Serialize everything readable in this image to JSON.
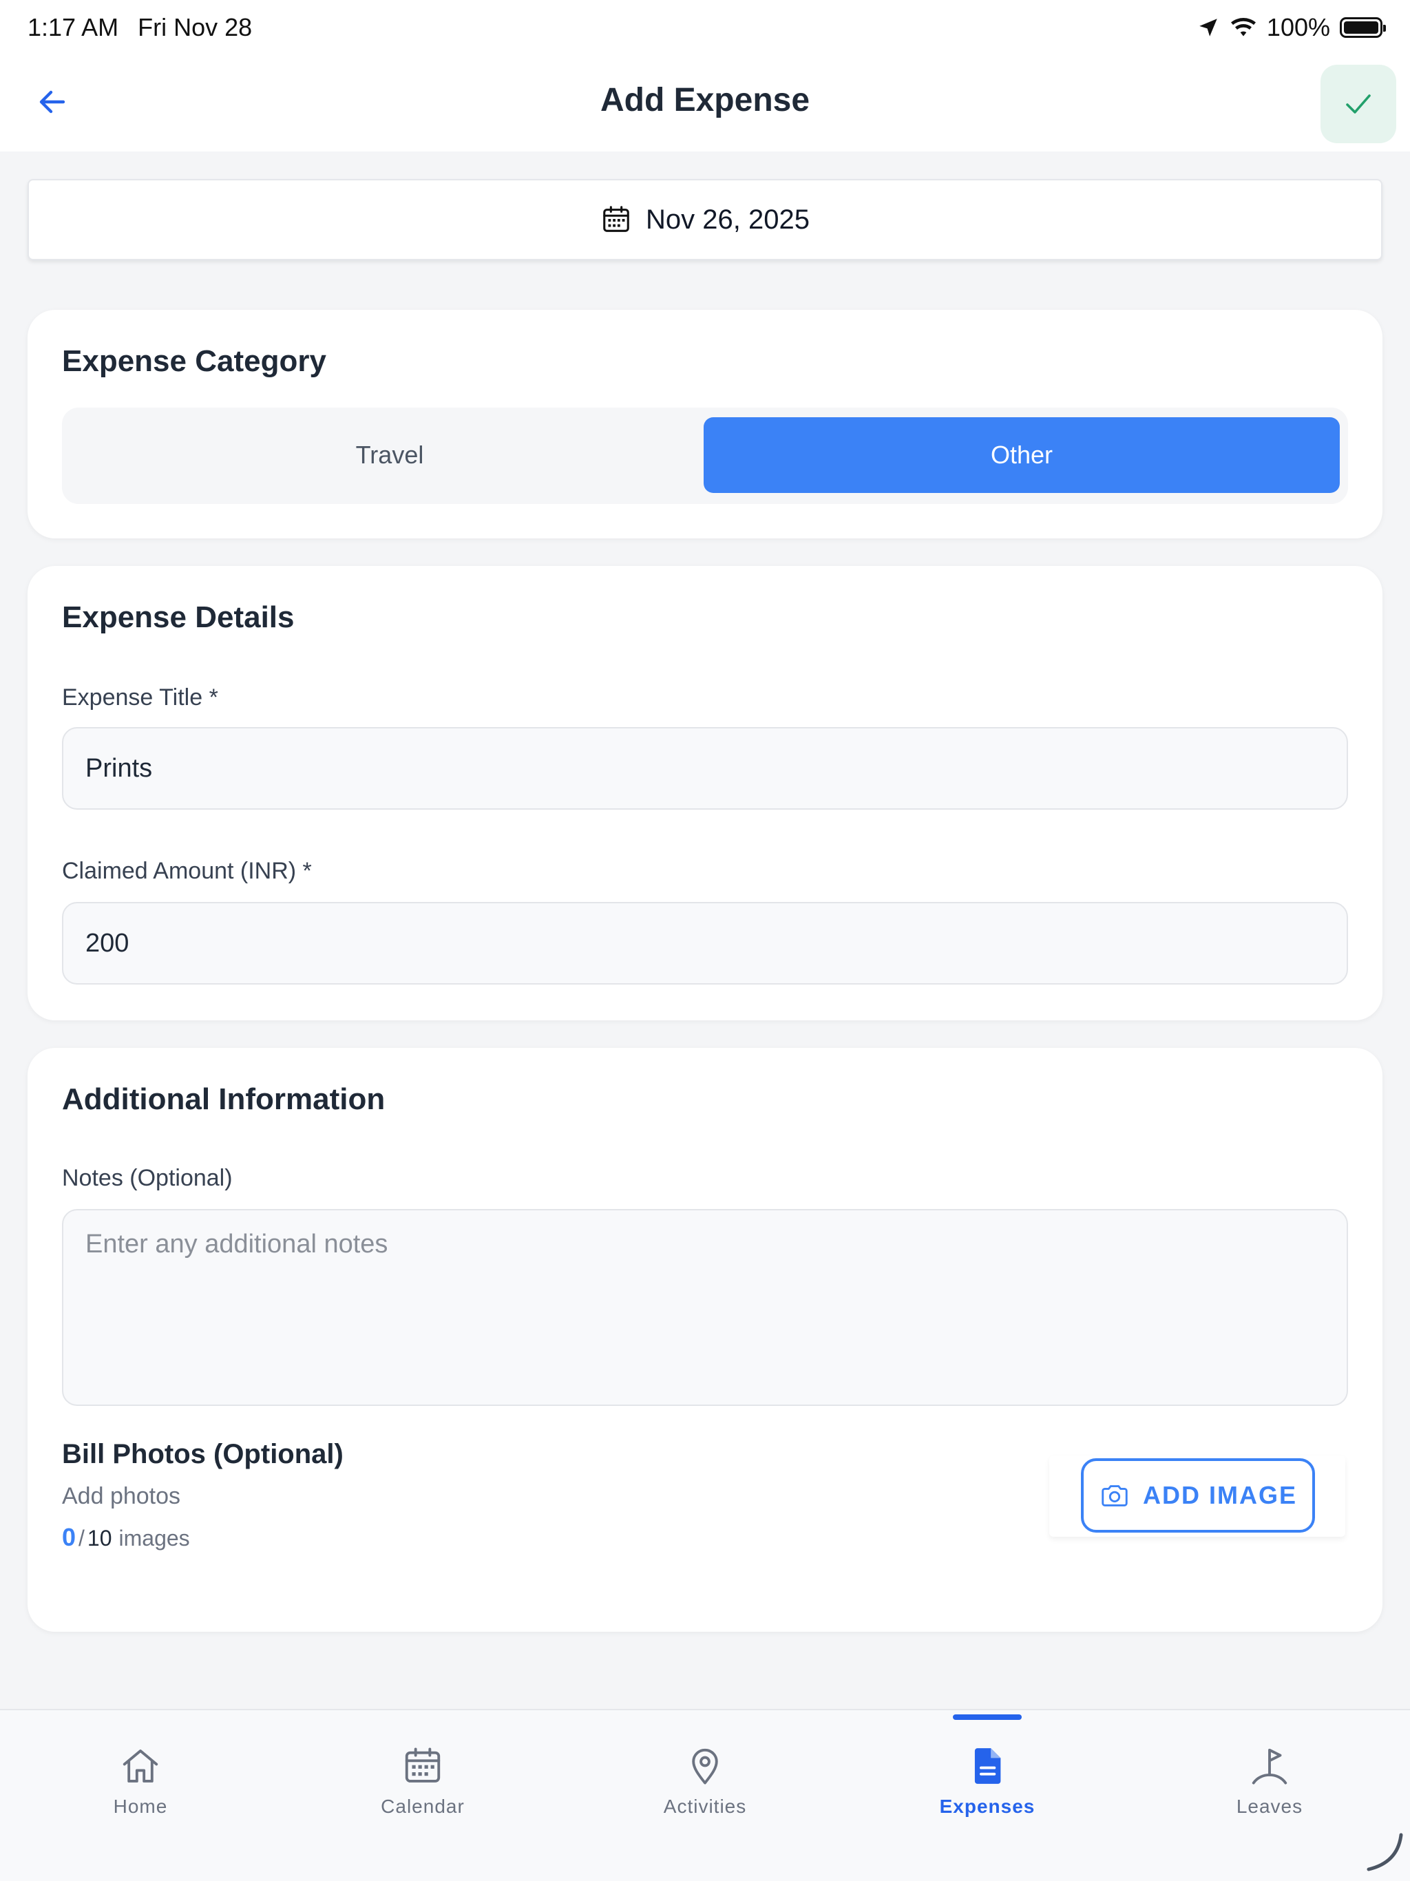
{
  "status_bar": {
    "time": "1:17 AM",
    "date": "Fri Nov 28",
    "battery": "100%"
  },
  "header": {
    "title": "Add Expense",
    "back_icon": "arrow-left-icon",
    "save_icon": "checkmark-icon"
  },
  "date_field": {
    "value": "Nov 26, 2025",
    "icon": "calendar-icon"
  },
  "category": {
    "title": "Expense Category",
    "options": [
      "Travel",
      "Other"
    ],
    "selected": "Other"
  },
  "details": {
    "title": "Expense Details",
    "title_label": "Expense Title *",
    "title_value": "Prints",
    "amount_label": "Claimed Amount (INR) *",
    "amount_value": "200"
  },
  "additional": {
    "title": "Additional Information",
    "notes_label": "Notes (Optional)",
    "notes_placeholder": "Enter any additional notes",
    "bill_title": "Bill Photos (Optional)",
    "bill_sub": "Add photos",
    "image_count": "0",
    "image_separator": "/",
    "image_max": "10",
    "image_unit": "images",
    "add_image_label": "ADD IMAGE",
    "add_image_icon": "camera-icon"
  },
  "nav": {
    "items": [
      {
        "label": "Home",
        "icon": "home-icon"
      },
      {
        "label": "Calendar",
        "icon": "calendar-icon"
      },
      {
        "label": "Activities",
        "icon": "map-pin-icon"
      },
      {
        "label": "Expenses",
        "icon": "document-icon"
      },
      {
        "label": "Leaves",
        "icon": "flag-icon"
      }
    ],
    "active": "Expenses"
  },
  "colors": {
    "accent": "#3b82f6",
    "nav_active": "#2563eb",
    "save_bg": "#e6f4ee",
    "save_check": "#22a06b"
  }
}
